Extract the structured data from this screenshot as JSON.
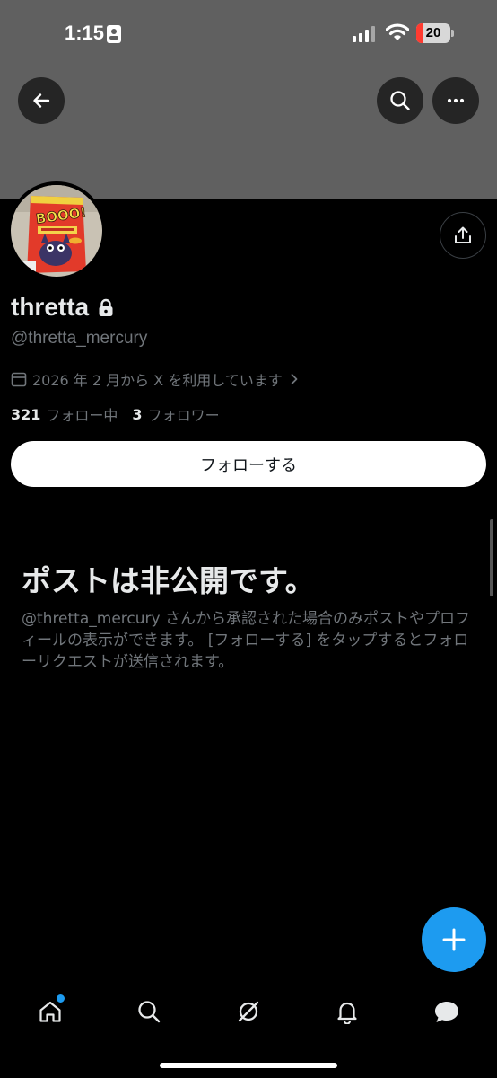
{
  "status_bar": {
    "time": "1:15",
    "battery_level": "20",
    "battery_fraction": 0.2,
    "battery_color": "#ff3b30"
  },
  "header": {
    "back_icon": "arrow-left-icon",
    "search_icon": "search-icon",
    "more_icon": "more-horizontal-icon",
    "banner_color": "#606060"
  },
  "profile": {
    "display_name": "thretta",
    "handle": "@thretta_mercury",
    "joined": "2026 年 2 月から X を利用しています",
    "following_count": "321",
    "following_label": "フォロー中",
    "followers_count": "3",
    "followers_label": "フォロワー",
    "follow_button": "フォローする",
    "avatar_text": "BOOO!"
  },
  "private_notice": {
    "title": "ポストは非公開です。",
    "description": "@thretta_mercury さんから承認された場合のみポストやプロフィールの表示ができます。 [フォローする] をタップするとフォローリクエストが送信されます。"
  },
  "fab": {
    "icon": "plus-icon",
    "color": "#1d9bf0"
  },
  "tab_bar": {
    "items": [
      "home-icon",
      "search-icon",
      "grok-icon",
      "bell-icon",
      "messages-icon"
    ],
    "accent": "#1d9bf0"
  }
}
